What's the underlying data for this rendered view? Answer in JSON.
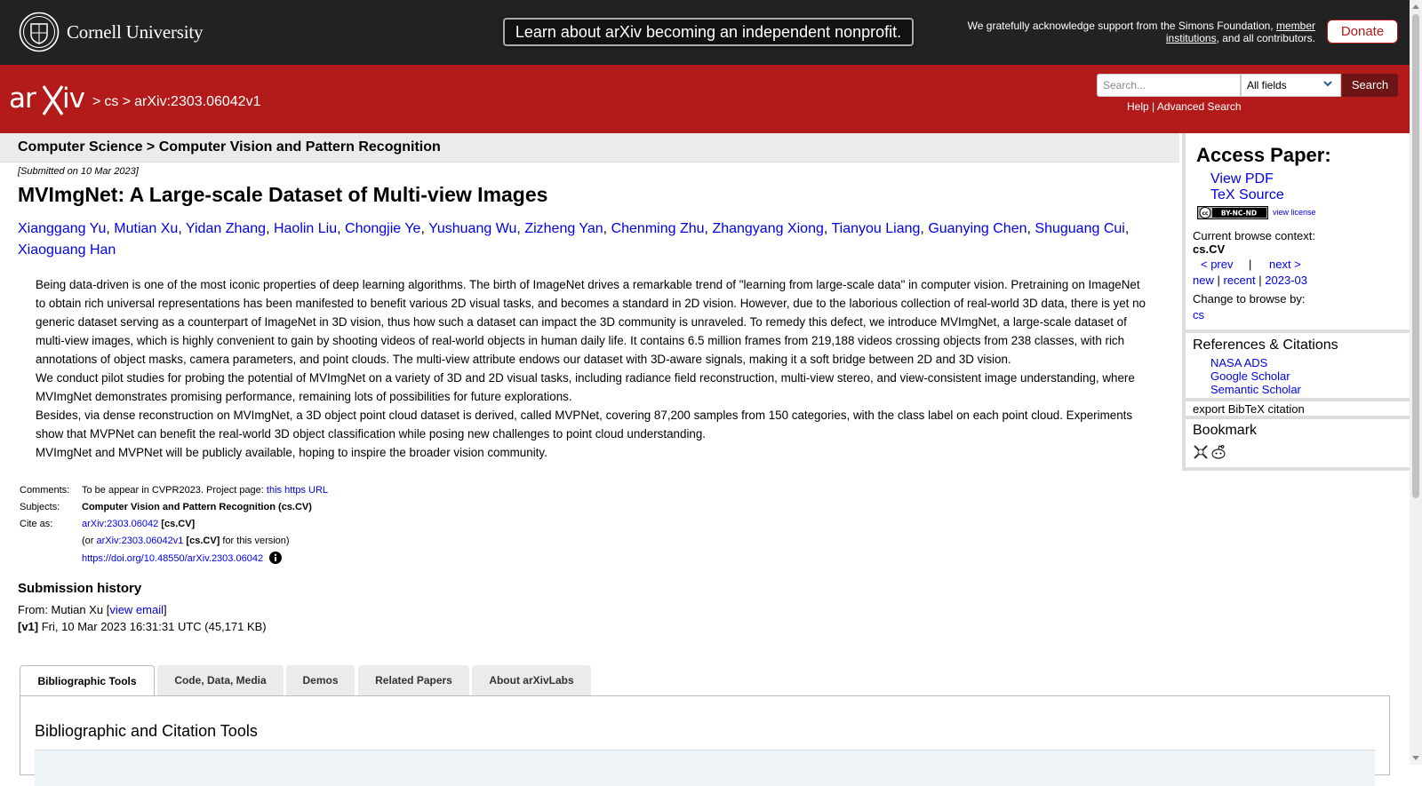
{
  "top": {
    "institution": "Cornell University",
    "announcement": "Learn about arXiv becoming an independent nonprofit.",
    "support_prefix": "We gratefully acknowledge support from the Simons Foundation,",
    "support_link": "member institutions",
    "support_suffix": ", and all contributors.",
    "donate": "Donate"
  },
  "header": {
    "logo": "arXiv",
    "breadcrumb_sep1": ">",
    "breadcrumb_cs": "cs",
    "breadcrumb_sep2": ">",
    "breadcrumb_id": "arXiv:2303.06042v1",
    "search_placeholder": "Search...",
    "search_field": "All fields",
    "search_button": "Search",
    "help": "Help",
    "help_sep": " | ",
    "advanced": "Advanced Search"
  },
  "paper": {
    "category_path": "Computer Science > Computer Vision and Pattern Recognition",
    "submitted": "[Submitted on 10 Mar 2023]",
    "title": "MVImgNet: A Large-scale Dataset of Multi-view Images",
    "authors": [
      "Xianggang Yu",
      "Mutian Xu",
      "Yidan Zhang",
      "Haolin Liu",
      "Chongjie Ye",
      "Yushuang Wu",
      "Zizheng Yan",
      "Chenming Zhu",
      "Zhangyang Xiong",
      "Tianyou Liang",
      "Guanying Chen",
      "Shuguang Cui",
      "Xiaoguang Han"
    ],
    "author_sep": ",",
    "abstract": [
      "Being data-driven is one of the most iconic properties of deep learning algorithms. The birth of ImageNet drives a remarkable trend of \"learning from large-scale data\" in computer vision. Pretraining on ImageNet to obtain rich universal representations has been manifested to benefit various 2D visual tasks, and becomes a standard in 2D vision. However, due to the laborious collection of real-world 3D data, there is yet no generic dataset serving as a counterpart of ImageNet in 3D vision, thus how such a dataset can impact the 3D community is unraveled. To remedy this defect, we introduce MVImgNet, a large-scale dataset of multi-view images, which is highly convenient to gain by shooting videos of real-world objects in human daily life. It contains 6.5 million frames from 219,188 videos crossing objects from 238 classes, with rich annotations of object masks, camera parameters, and point clouds. The multi-view attribute endows our dataset with 3D-aware signals, making it a soft bridge between 2D and 3D vision.",
      "We conduct pilot studies for probing the potential of MVImgNet on a variety of 3D and 2D visual tasks, including radiance field reconstruction, multi-view stereo, and view-consistent image understanding, where MVImgNet demonstrates promising performance, remaining lots of possibilities for future explorations.",
      "Besides, via dense reconstruction on MVImgNet, a 3D object point cloud dataset is derived, called MVPNet, covering 87,200 samples from 150 categories, with the class label on each point cloud. Experiments show that MVPNet can benefit the real-world 3D object classification while posing new challenges to point cloud understanding.",
      "MVImgNet and MVPNet will be publicly available, hoping to inspire the broader vision community."
    ],
    "comments_label": "Comments:",
    "comments_text": "To be appear in CVPR2023. Project page: ",
    "comments_link": "this https URL",
    "subjects_label": "Subjects:",
    "subjects": "Computer Vision and Pattern Recognition (cs.CV)",
    "cite_label": "Cite as:",
    "cite_id": "arXiv:2303.06042",
    "cite_cat": "[cs.CV]",
    "cite_or": "(or ",
    "cite_version_id": "arXiv:2303.06042v1",
    "cite_version_cat": "[cs.CV]",
    "cite_version_suffix": " for this version)",
    "doi": "https://doi.org/10.48550/arXiv.2303.06042"
  },
  "history": {
    "heading": "Submission history",
    "from_prefix": "From: Mutian Xu [",
    "view_email": "view email",
    "from_suffix": "]",
    "v1_tag": "[v1]",
    "v1_text": " Fri, 10 Mar 2023 16:31:31 UTC (45,171 KB)"
  },
  "tabs": [
    "Bibliographic Tools",
    "Code, Data, Media",
    "Demos",
    "Related Papers",
    "About arXivLabs"
  ],
  "panel_title": "Bibliographic and Citation Tools",
  "sidebar": {
    "access_heading": "Access Paper:",
    "view_pdf": "View PDF",
    "tex_source": "TeX Source",
    "license_badge": "BY-NC-ND",
    "view_license": "view license",
    "browse_context": "Current browse context:",
    "context_value": "cs.CV",
    "prev": "< prev",
    "nav_sep": "|",
    "next": "next >",
    "new": "new",
    "recent": "recent",
    "month": "2023-03",
    "change_browse": "Change to browse by:",
    "browse_cs": "cs",
    "refs_heading": "References & Citations",
    "refs": [
      "NASA ADS",
      "Google Scholar",
      "Semantic Scholar"
    ],
    "bibtex": "export BibTeX citation",
    "bookmark_heading": "Bookmark"
  },
  "colors": {
    "arxiv_red": "#b31b1b",
    "top_bar": "#222222",
    "link": "#0000ee"
  }
}
